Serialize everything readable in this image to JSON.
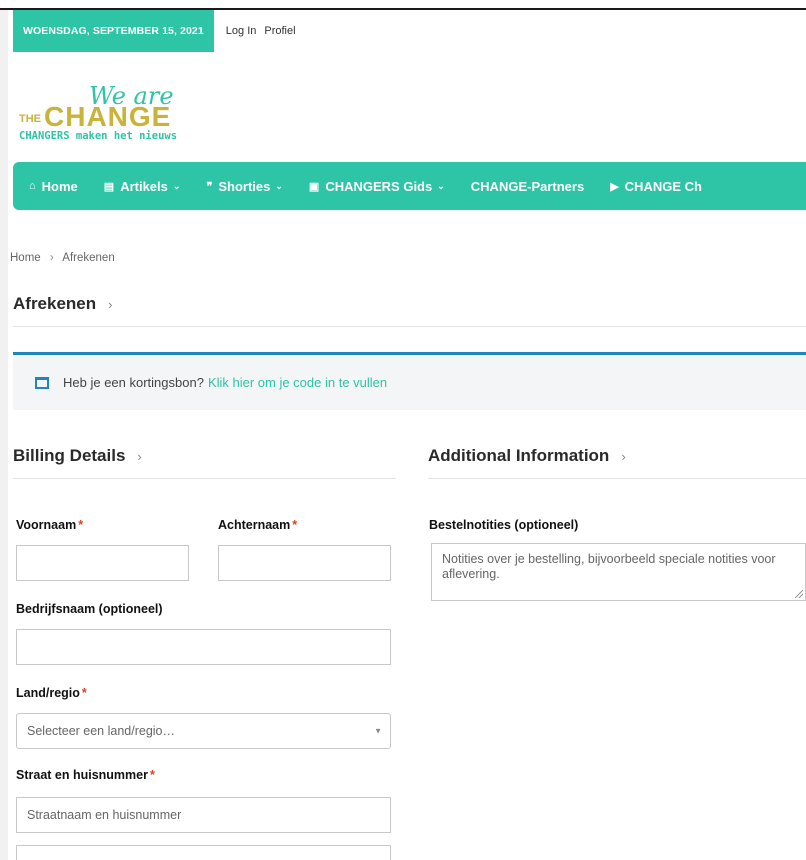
{
  "topbar": {
    "date": "WOENSDAG, SEPTEMBER 15, 2021",
    "login": "Log In",
    "profile": "Profiel"
  },
  "logo": {
    "script_text": "We are",
    "main_text": "CHANGE",
    "prefix": "THE",
    "tagline": "CHANGERS maken het nieuws"
  },
  "nav": {
    "items": [
      {
        "label": "Home",
        "icon": "home-icon",
        "dropdown": false
      },
      {
        "label": "Artikels",
        "icon": "newspaper-icon",
        "dropdown": true
      },
      {
        "label": "Shorties",
        "icon": "quote-icon",
        "dropdown": true
      },
      {
        "label": "CHANGERS Gids",
        "icon": "id-card-icon",
        "dropdown": true
      },
      {
        "label": "CHANGE-Partners",
        "icon": "",
        "dropdown": false
      },
      {
        "label": "CHANGE Ch",
        "icon": "youtube-icon",
        "dropdown": false
      }
    ]
  },
  "breadcrumb": {
    "home": "Home",
    "separator": "›",
    "current": "Afrekenen"
  },
  "page": {
    "title": "Afrekenen",
    "title_arrow": "›"
  },
  "coupon": {
    "text": "Heb je een kortingsbon?",
    "link": "Klik hier om je code in te vullen"
  },
  "billing": {
    "title": "Billing Details",
    "title_arrow": "›",
    "first_name_label": "Voornaam",
    "last_name_label": "Achternaam",
    "company_label": "Bedrijfsnaam (optioneel)",
    "country_label": "Land/regio",
    "country_placeholder": "Selecteer een land/regio…",
    "street_label": "Straat en huisnummer",
    "street_placeholder": "Straatnaam en huisnummer",
    "required_mark": "*"
  },
  "additional": {
    "title": "Additional Information",
    "title_arrow": "›",
    "notes_label": "Bestelnotities (optioneel)",
    "notes_placeholder": "Notities over je bestelling, bijvoorbeeld speciale notities voor aflevering."
  },
  "colors": {
    "accent": "#2ec4a6",
    "info_border": "#1e85be",
    "required": "#e2401c",
    "logo_gold": "#c9b33a"
  }
}
